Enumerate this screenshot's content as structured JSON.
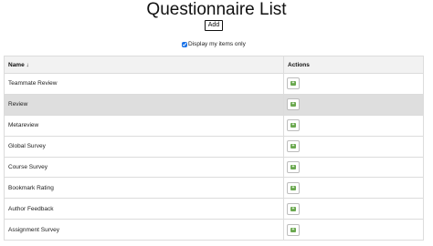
{
  "page": {
    "title": "Questionnaire List",
    "add_label": "Add",
    "filter_label": "Display my items only",
    "filter_checked": true
  },
  "table": {
    "headers": {
      "name": "Name ↓",
      "actions": "Actions"
    },
    "rows": [
      {
        "name": "Teammate Review",
        "highlighted": false
      },
      {
        "name": "Review",
        "highlighted": true
      },
      {
        "name": "Metareview",
        "highlighted": false
      },
      {
        "name": "Global Survey",
        "highlighted": false
      },
      {
        "name": "Course Survey",
        "highlighted": false
      },
      {
        "name": "Bookmark Rating",
        "highlighted": false
      },
      {
        "name": "Author Feedback",
        "highlighted": false
      },
      {
        "name": "Assignment Survey",
        "highlighted": false
      }
    ],
    "action_icon": "add-square-icon",
    "action_icon_color": "#6aa84f"
  }
}
